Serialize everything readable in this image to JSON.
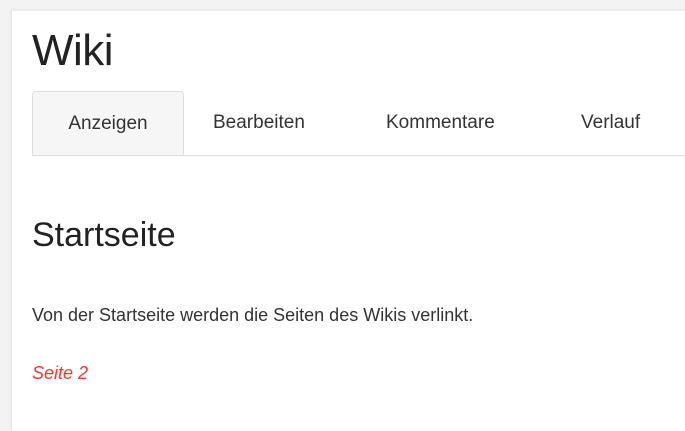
{
  "wiki": {
    "title": "Wiki"
  },
  "tabs": [
    {
      "label": "Anzeigen",
      "active": true
    },
    {
      "label": "Bearbeiten",
      "active": false
    },
    {
      "label": "Kommentare",
      "active": false
    },
    {
      "label": "Verlauf",
      "active": false
    }
  ],
  "page": {
    "heading": "Startseite",
    "text": "Von der Startseite werden die Seiten des Wikis verlinkt.",
    "link_label": "Seite 2",
    "link_color": "#ff3333"
  }
}
